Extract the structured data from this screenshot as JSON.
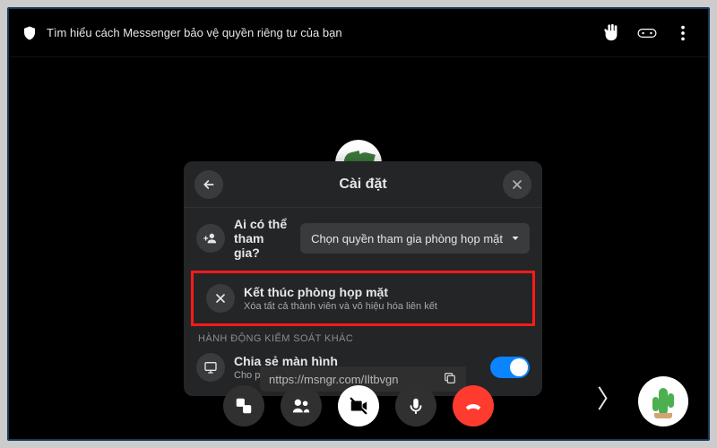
{
  "topbar": {
    "privacy_text": "Tìm hiểu cách Messenger bảo vệ quyền riêng tư của bạn"
  },
  "panel": {
    "title": "Cài đặt",
    "who_can_join_label": "Ai có thể tham gia?",
    "permission_dropdown": "Chọn quyền tham gia phòng họp mặt",
    "end_room_title": "Kết thúc phòng họp mặt",
    "end_room_sub": "Xóa tất cả thành viên và vô hiệu hóa liên kết",
    "other_controls_header": "HÀNH ĐỘNG KIỂM SOÁT KHÁC",
    "screen_share_title": "Chia sẻ màn hình",
    "screen_share_sub": "Cho phép người khác chia sẻ màn hình"
  },
  "url_strip": {
    "text": "nttps://msngr.com/Iltbvgn"
  },
  "bracket": "〉"
}
